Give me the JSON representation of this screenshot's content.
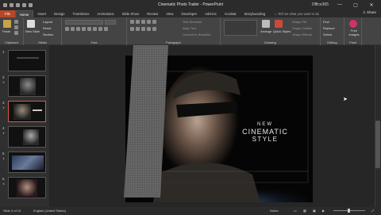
{
  "window": {
    "title": "Cinematic Photo Trailer  -  PowerPoint",
    "account": "Office365",
    "share": "Share",
    "controls": [
      "—",
      "▢",
      "✕"
    ]
  },
  "tabs": [
    "File",
    "Home",
    "Insert",
    "Design",
    "Transitions",
    "Animations",
    "Slide Show",
    "Review",
    "View",
    "Developer",
    "Add-ins",
    "Acrobat",
    "Storyboarding"
  ],
  "active_tab": "Home",
  "tell_me": "Tell me what you want to do",
  "ribbon": {
    "clipboard": {
      "label": "Clipboard",
      "paste": "Paste"
    },
    "slides": {
      "label": "Slides",
      "new_slide": "New Slide",
      "layout": "Layout",
      "reset": "Reset",
      "section": "Section"
    },
    "font": {
      "label": "Font"
    },
    "paragraph": {
      "label": "Paragraph",
      "text_direction": "Text Direction",
      "align_text": "Align Text",
      "convert_smartart": "Convert to SmartArt"
    },
    "drawing": {
      "label": "Drawing",
      "arrange": "Arrange",
      "quick_styles": "Quick Styles",
      "shape_fill": "Shape Fill",
      "shape_outline": "Shape Outline",
      "shape_effects": "Shape Effects"
    },
    "editing": {
      "label": "Editing",
      "find": "Find",
      "replace": "Replace",
      "select": "Select"
    },
    "pixel": {
      "label": "Pixel",
      "free_images": "Free Images"
    }
  },
  "thumbnails": [
    {
      "num": "1"
    },
    {
      "num": "2"
    },
    {
      "num": "3"
    },
    {
      "num": "4"
    },
    {
      "num": "5"
    },
    {
      "num": "6"
    }
  ],
  "selected_slide": "3",
  "slide": {
    "line1": "NEW",
    "line2": "CINEMATIC",
    "line3": "STYLE"
  },
  "status": {
    "slide_info": "Slide 3 of 13",
    "language": "English (United States)",
    "notes": "Notes"
  },
  "colors": {
    "file_tab": "#b7472a",
    "selected_thumb": "#e0574c",
    "pixel_icon": "#d62f6d"
  }
}
